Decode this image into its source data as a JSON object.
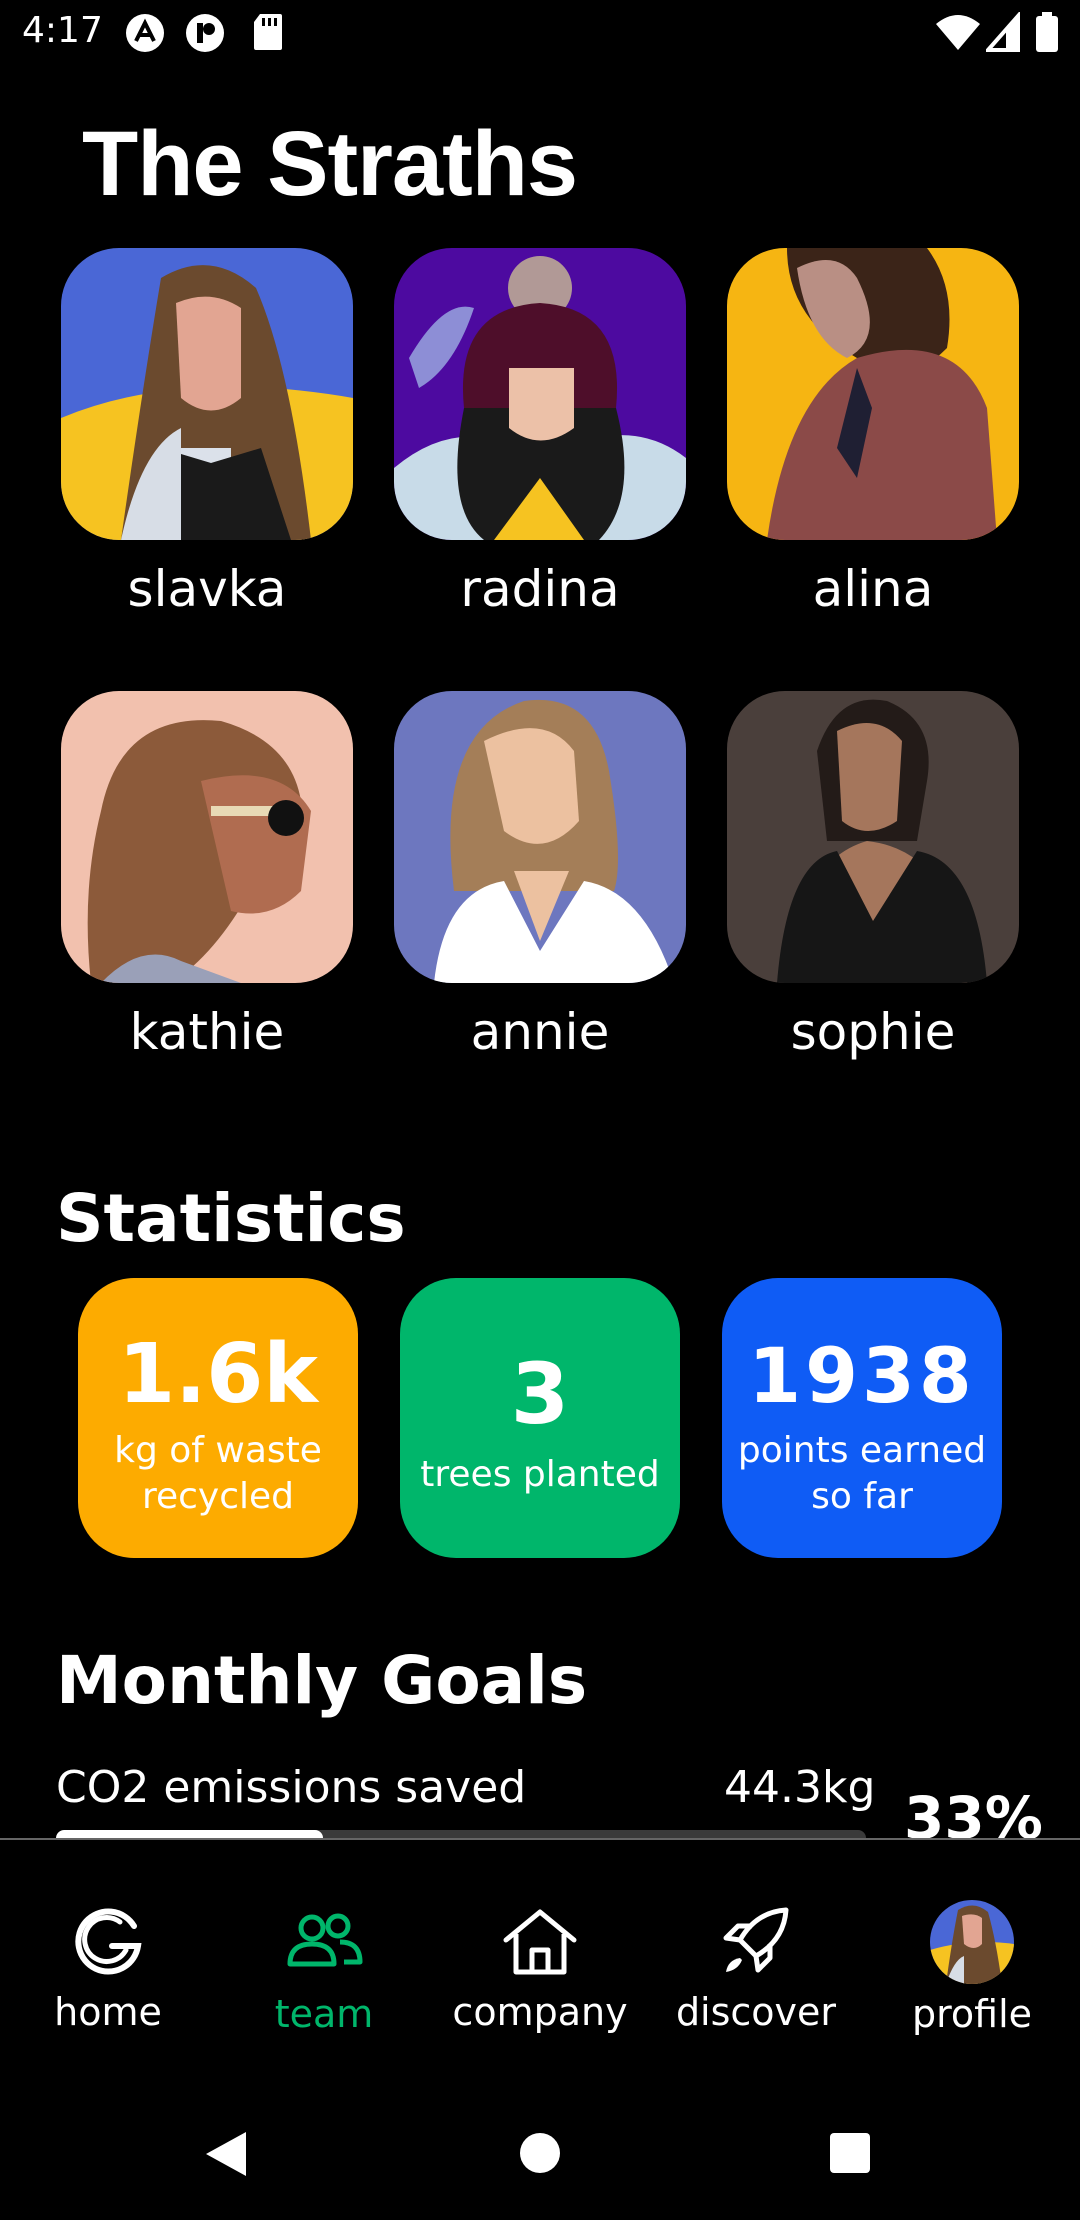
{
  "status_bar": {
    "time": "4:17",
    "left_icons": [
      "app-notification-icon",
      "app-notification-icon",
      "sd-card-icon"
    ],
    "right_icons": [
      "wifi-icon",
      "cell-signal-icon",
      "battery-icon"
    ]
  },
  "team": {
    "title": "The Straths",
    "members": [
      {
        "name": "slavka",
        "bg": "#4a67d6"
      },
      {
        "name": "radina",
        "bg": "#4d0aa0"
      },
      {
        "name": "alina",
        "bg": "#f6b512"
      },
      {
        "name": "kathie",
        "bg": "#f2c1ae"
      },
      {
        "name": "annie",
        "bg": "#6d77bf"
      },
      {
        "name": "sophie",
        "bg": "#4a3f3b"
      }
    ]
  },
  "statistics": {
    "title": "Statistics",
    "cards": [
      {
        "value": "1.6k",
        "label_line1": "kg of waste",
        "label_line2": "recycled",
        "color": "#fdab00"
      },
      {
        "value": "3",
        "label_line1": "trees planted",
        "label_line2": "",
        "color": "#00b66b"
      },
      {
        "value": "1938",
        "label_line1": "points earned",
        "label_line2": "so far",
        "color": "#0f5cf5"
      }
    ]
  },
  "monthly_goals": {
    "title": "Monthly Goals",
    "goals": [
      {
        "label": "CO2 emissions saved",
        "amount": "44.3kg",
        "percent": "33%",
        "progress": 0.33
      }
    ]
  },
  "bottom_nav": {
    "items": [
      {
        "label": "home",
        "icon": "home-logo-icon",
        "active": false
      },
      {
        "label": "team",
        "icon": "team-icon",
        "active": true
      },
      {
        "label": "company",
        "icon": "company-icon",
        "active": false
      },
      {
        "label": "discover",
        "icon": "rocket-icon",
        "active": false
      },
      {
        "label": "profile",
        "icon": "profile-avatar",
        "active": false
      }
    ],
    "active_color": "#00b66b"
  },
  "system_nav": {
    "icons": [
      "back-icon",
      "home-circle-icon",
      "recents-icon"
    ]
  }
}
